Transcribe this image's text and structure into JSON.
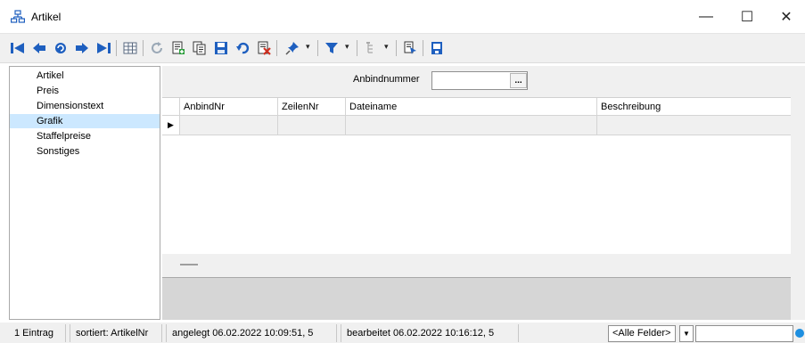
{
  "window": {
    "title": "Artikel",
    "minimize_glyph": "—",
    "maximize_glyph": "☐",
    "close_glyph": "✕"
  },
  "toolbar": {
    "icons": [
      "first-record-icon",
      "prev-record-icon",
      "refresh-link-icon",
      "next-record-icon",
      "last-record-icon",
      "table-view-icon",
      "reload-icon",
      "new-record-icon",
      "copy-record-icon",
      "save-icon",
      "undo-icon",
      "delete-icon",
      "pin-icon",
      "filter-icon",
      "tree-icon",
      "export-icon",
      "exit-icon"
    ],
    "accent_blue": "#1e5fbf",
    "accent_red": "#d03020",
    "dropdown_glyph": "▾"
  },
  "sidebar": {
    "items": [
      {
        "label": "Artikel"
      },
      {
        "label": "Preis"
      },
      {
        "label": "Dimensionstext"
      },
      {
        "label": "Grafik",
        "active": true
      },
      {
        "label": "Staffelpreise"
      },
      {
        "label": "Sonstiges"
      }
    ]
  },
  "form": {
    "anbind_label": "Anbindnummer",
    "anbind_value": "",
    "lookup_button": "..."
  },
  "grid": {
    "columns": [
      "AnbindNr",
      "ZeilenNr",
      "Dateiname",
      "Beschreibung"
    ],
    "rows": [
      {
        "AnbindNr": "",
        "ZeilenNr": "",
        "Dateiname": "",
        "Beschreibung": ""
      }
    ],
    "row_indicator": "▶"
  },
  "statusbar": {
    "count": "1 Eintrag",
    "sort": "sortiert: ArtikelNr",
    "created": "angelegt 06.02.2022 10:09:51,  5",
    "edited": "bearbeitet 06.02.2022 10:16:12,  5",
    "field_filter": "<Alle Felder>",
    "search_value": ""
  }
}
